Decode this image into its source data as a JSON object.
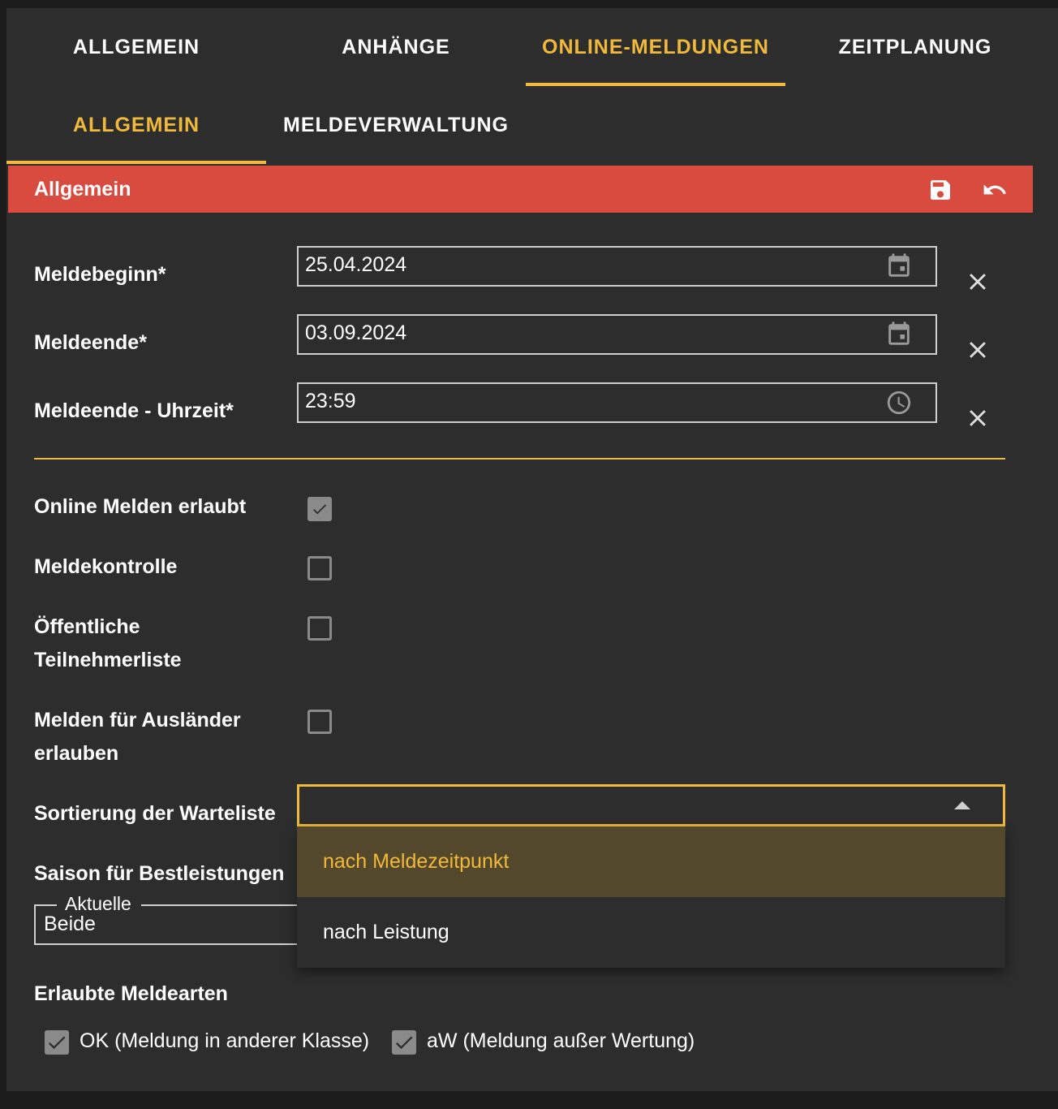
{
  "tabs_primary": [
    {
      "label": "ALLGEMEIN",
      "active": false
    },
    {
      "label": "ANHÄNGE",
      "active": false
    },
    {
      "label": "ONLINE-MELDUNGEN",
      "active": true
    },
    {
      "label": "ZEITPLANUNG",
      "active": false
    }
  ],
  "tabs_secondary": [
    {
      "label": "ALLGEMEIN",
      "active": true
    },
    {
      "label": "MELDEVERWALTUNG",
      "active": false
    }
  ],
  "panel": {
    "title": "Allgemein",
    "icons": {
      "save": "save-icon",
      "undo": "undo-icon"
    }
  },
  "fields": {
    "meldebeginn": {
      "label": "Meldebeginn*",
      "value": "25.04.2024",
      "icon": "calendar-icon"
    },
    "meldeende": {
      "label": "Meldeende*",
      "value": "03.09.2024",
      "icon": "calendar-icon"
    },
    "meldeende_uhrzeit": {
      "label": "Meldeende - Uhrzeit*",
      "value": "23:59",
      "icon": "clock-icon"
    }
  },
  "checkboxes": {
    "online_melden": {
      "label": "Online Melden erlaubt",
      "checked": true
    },
    "meldekontrolle": {
      "label": "Meldekontrolle",
      "checked": false
    },
    "oeffentliche_liste": {
      "label_line1": "Öffentliche",
      "label_line2": "Teilnehmerliste",
      "checked": false
    },
    "auslaender": {
      "label_line1": "Melden für Ausländer",
      "label_line2": "erlauben",
      "checked": false
    }
  },
  "sortierung": {
    "label": "Sortierung der Warteliste",
    "value": "",
    "options": [
      "nach Meldezeitpunkt",
      "nach Leistung"
    ],
    "highlighted": "nach Meldezeitpunkt"
  },
  "saison": {
    "label": "Saison für Bestleistungen",
    "legend": "Aktuelle",
    "value": "Beide"
  },
  "meldearten": {
    "label": "Erlaubte Meldearten",
    "items": [
      {
        "label": "OK (Meldung in anderer Klasse)",
        "checked": true
      },
      {
        "label": "aW (Meldung außer Wertung)",
        "checked": true
      }
    ]
  },
  "colors": {
    "accent": "#f0b93a",
    "header_red": "#d94a3f",
    "background": "#2d2d2d",
    "highlight_option": "#54482c"
  }
}
